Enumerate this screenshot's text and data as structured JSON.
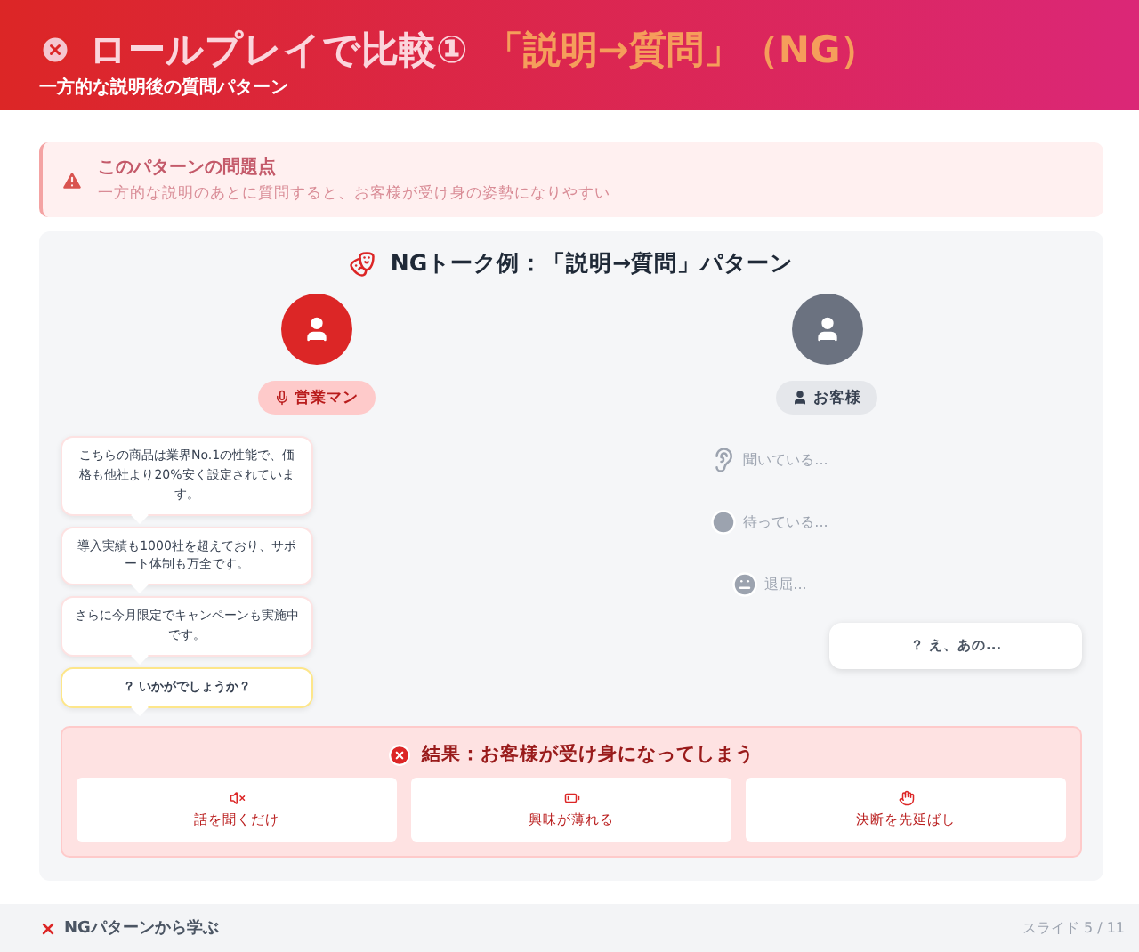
{
  "header": {
    "title": "ロールプレイで比較①",
    "title_highlight": "「説明→質問」（NG）",
    "subtitle": "一方的な説明後の質問パターン"
  },
  "alert": {
    "title": "このパターンの問題点",
    "text": "一方的な説明のあとに質問すると、お客様が受け身の姿勢になりやすい"
  },
  "panel": {
    "title": "NGトーク例：「説明→質問」パターン",
    "sales": {
      "label": "営業マン",
      "bubbles": [
        {
          "kind": "statement",
          "text": "こちらの商品は業界No.1の性能で、価格も他社より20%安く設定されています。"
        },
        {
          "kind": "statement",
          "text": "導入実績も1000社を超えており、サポート体制も万全です。"
        },
        {
          "kind": "statement",
          "text": "さらに今月限定でキャンペーンも実施中です。"
        },
        {
          "kind": "question",
          "text": "？ いかがでしょうか？"
        }
      ]
    },
    "customer": {
      "label": "お客様",
      "states": [
        {
          "kind": "listening",
          "text": "聞いている..."
        },
        {
          "kind": "waiting",
          "text": "待っている..."
        },
        {
          "kind": "bored",
          "text": "退屈..."
        }
      ],
      "reply": "？ え、あの..."
    },
    "result": {
      "title": "結果：お客様が受け身になってしまう",
      "items": [
        {
          "kind": "mute",
          "text": "話を聞くだけ"
        },
        {
          "kind": "battery",
          "text": "興味が薄れる"
        },
        {
          "kind": "hand",
          "text": "決断を先延ばし"
        }
      ]
    }
  },
  "footer": {
    "label": "NGパターンから学ぶ",
    "page": "スライド 5 / 11"
  }
}
